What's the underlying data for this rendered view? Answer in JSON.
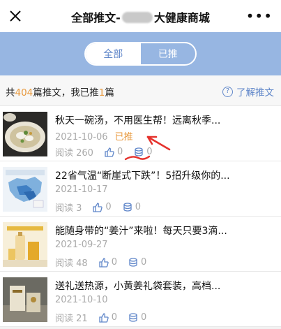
{
  "header": {
    "title_prefix": "全部推文-",
    "title_suffix": "大健康商城",
    "more": "•••"
  },
  "tabs": [
    {
      "label": "全部",
      "active": true
    },
    {
      "label": "已推",
      "active": false
    }
  ],
  "summary": {
    "p1": "共",
    "total": "404",
    "p2": "篇推文，我已推",
    "pushed": "1",
    "p3": "篇",
    "help_label": "了解推文"
  },
  "articles": [
    {
      "title": "秋天一碗汤，不用医生帮！远离秋季...",
      "date": "2021-10-06",
      "status": "已推",
      "reads_label": "阅读 260",
      "likes": "0",
      "shares": "0"
    },
    {
      "title": "22省气温“断崖式下跌”！5招升级你的...",
      "date": "2021-10-17",
      "status": "",
      "reads_label": "阅读 3",
      "likes": "0",
      "shares": "0"
    },
    {
      "title": "能随身带的“姜汁”来啦！每天只要3滴...",
      "date": "2021-09-27",
      "status": "",
      "reads_label": "阅读 48",
      "likes": "0",
      "shares": "0"
    },
    {
      "title": "送礼送热源，小黄姜礼袋套装，高档...",
      "date": "2021-10-10",
      "status": "",
      "reads_label": "阅读 21",
      "likes": "0",
      "shares": "0"
    }
  ],
  "colors": {
    "accent": "#5f86c9",
    "band": "#97b6e2",
    "highlight": "#e8983b",
    "annotation": "#e5322d"
  }
}
